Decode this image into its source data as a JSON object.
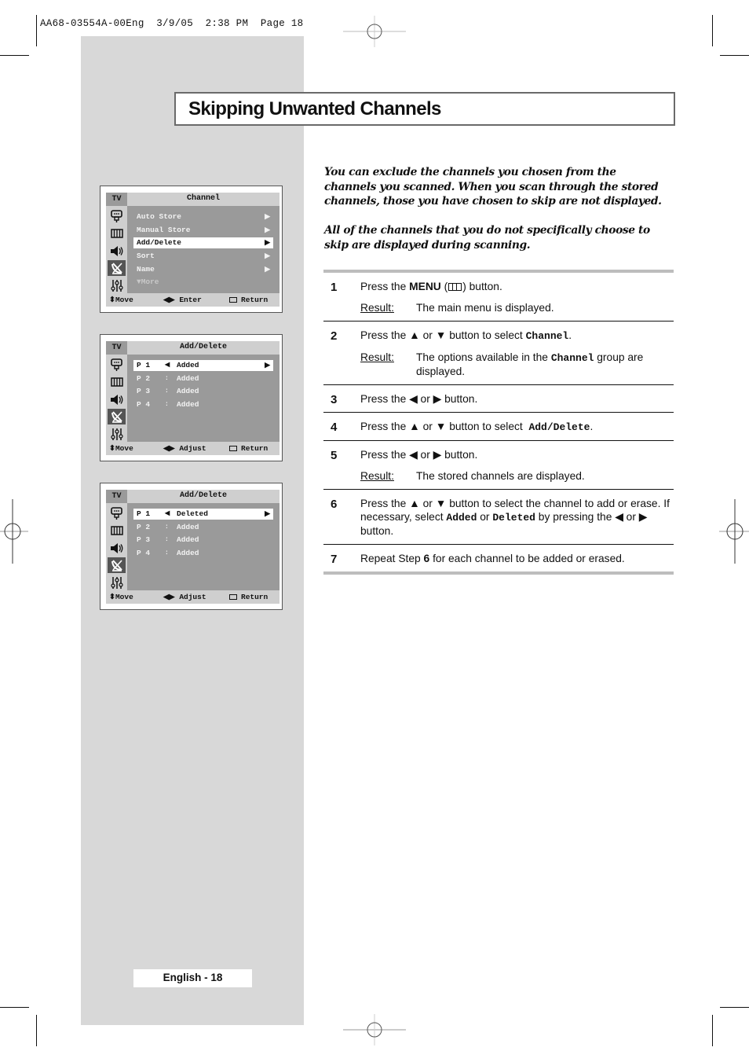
{
  "slug": {
    "text": "AA68-03554A-00Eng  3/9/05  2:38 PM  Page 18"
  },
  "page": {
    "title": "Skipping Unwanted Channels",
    "footer": "English - 18"
  },
  "intro": {
    "paragraph_1": "You can exclude the channels you chosen from the channels you scanned. When you scan through the stored channels, those you have chosen to skip are not displayed.",
    "paragraph_2": "All of the channels that you do not specifically choose to skip are displayed during scanning."
  },
  "osd_screens": [
    {
      "tv_label": "TV",
      "header": "Channel",
      "icons": [
        "picture-icon",
        "setup-icon",
        "sound-icon",
        "channel-antenna-icon",
        "function-sliders-icon"
      ],
      "active_icon_index": 3,
      "items": [
        {
          "label": "Auto Store",
          "arrow": "▶",
          "selected": false
        },
        {
          "label": "Manual Store",
          "arrow": "▶",
          "selected": false
        },
        {
          "label": "Add/Delete",
          "arrow": "▶",
          "selected": true
        },
        {
          "label": "Sort",
          "arrow": "▶",
          "selected": false
        },
        {
          "label": "Name",
          "arrow": "▶",
          "selected": false
        }
      ],
      "more": "▼More",
      "footer": {
        "move": "⬍Move",
        "enter": "◀▶ Enter",
        "return": "Return"
      }
    },
    {
      "tv_label": "TV",
      "header": "Add/Delete",
      "active_icon_index": 3,
      "rows": [
        {
          "program": "P 1",
          "sep": "◀",
          "value": "Added",
          "arrow": "▶",
          "selected": true
        },
        {
          "program": "P 2",
          "sep": ":",
          "value": "Added",
          "arrow": "",
          "selected": false
        },
        {
          "program": "P 3",
          "sep": ":",
          "value": "Added",
          "arrow": "",
          "selected": false
        },
        {
          "program": "P 4",
          "sep": ":",
          "value": "Added",
          "arrow": "",
          "selected": false
        }
      ],
      "footer": {
        "move": "⬍Move",
        "enter": "◀▶ Adjust",
        "return": "Return"
      }
    },
    {
      "tv_label": "TV",
      "header": "Add/Delete",
      "active_icon_index": 3,
      "rows": [
        {
          "program": "P 1",
          "sep": "◀",
          "value": "Deleted",
          "arrow": "▶",
          "selected": true
        },
        {
          "program": "P 2",
          "sep": ":",
          "value": "Added",
          "arrow": "",
          "selected": false
        },
        {
          "program": "P 3",
          "sep": ":",
          "value": "Added",
          "arrow": "",
          "selected": false
        },
        {
          "program": "P 4",
          "sep": ":",
          "value": "Added",
          "arrow": "",
          "selected": false
        }
      ],
      "footer": {
        "move": "⬍Move",
        "enter": "◀▶ Adjust",
        "return": "Return"
      }
    }
  ],
  "steps": {
    "result_label": "Result:",
    "items": [
      {
        "num": "1",
        "a": "Press the ",
        "b": "MENU",
        "c": " (",
        "d": ") button.",
        "result": "The main menu is displayed."
      },
      {
        "num": "2",
        "a": "Press the ▲ or ▼ button to select ",
        "code": "Channel",
        "c": ".",
        "result_a": "The options available in the ",
        "result_code": "Channel",
        "result_b": " group are displayed."
      },
      {
        "num": "3",
        "a": "Press the ◀ or ▶ button."
      },
      {
        "num": "4",
        "a": "Press the ▲ or ▼ button to select  ",
        "code": "Add/Delete",
        "c": "."
      },
      {
        "num": "5",
        "a": "Press the ◀ or ▶ button.",
        "result": "The stored channels are displayed."
      },
      {
        "num": "6",
        "a": "Press the ▲ or ▼  button to select the channel to add or erase. If necessary, select ",
        "code1": "Added",
        "b": " or ",
        "code2": "Deleted",
        "c": " by pressing the ◀ or ▶ button."
      },
      {
        "num": "7",
        "a": "Repeat Step ",
        "b": "6",
        "c": " for each channel to be added or erased."
      }
    ]
  }
}
